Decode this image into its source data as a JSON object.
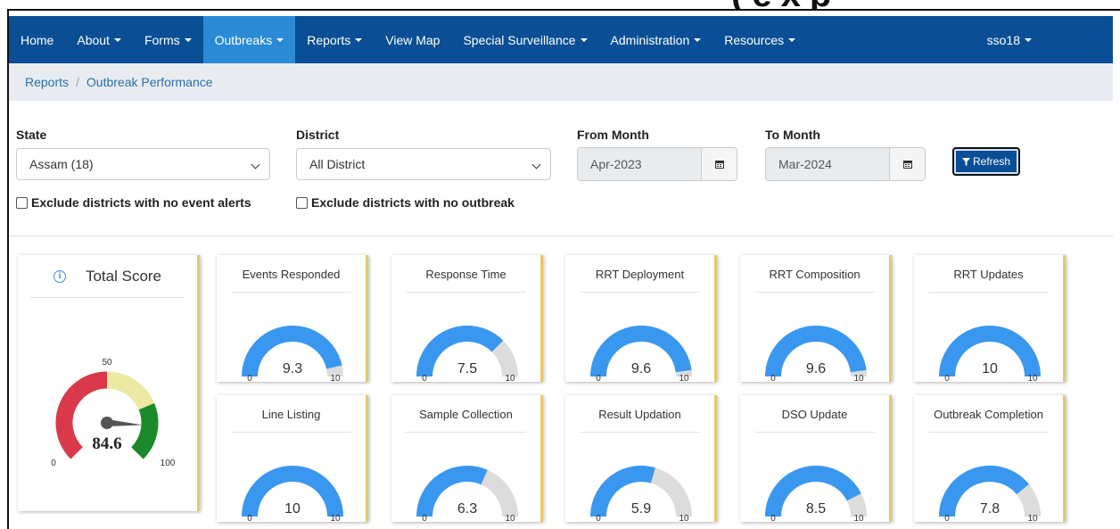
{
  "header_fragment": "(exp",
  "nav": {
    "items": [
      {
        "label": "Home",
        "caret": false,
        "active": false
      },
      {
        "label": "About",
        "caret": true,
        "active": false
      },
      {
        "label": "Forms",
        "caret": true,
        "active": false
      },
      {
        "label": "Outbreaks",
        "caret": true,
        "active": true
      },
      {
        "label": "Reports",
        "caret": true,
        "active": false
      },
      {
        "label": "View Map",
        "caret": false,
        "active": false
      },
      {
        "label": "Special Surveillance",
        "caret": true,
        "active": false
      },
      {
        "label": "Administration",
        "caret": true,
        "active": false
      },
      {
        "label": "Resources",
        "caret": true,
        "active": false
      }
    ],
    "user": "sso18"
  },
  "breadcrumb": {
    "parent": "Reports",
    "separator": "/",
    "current": "Outbreak Performance"
  },
  "filters": {
    "state_label": "State",
    "state_value": "Assam (18)",
    "district_label": "District",
    "district_value": "All District",
    "from_label": "From Month",
    "from_value": "Apr-2023",
    "to_label": "To Month",
    "to_value": "Mar-2024",
    "refresh_label": "Refresh",
    "exclude_alerts_label": "Exclude districts with no event alerts",
    "exclude_outbreak_label": "Exclude districts with no outbreak"
  },
  "total_score": {
    "title": "Total Score",
    "value": "84.6",
    "min": "0",
    "mid": "50",
    "max": "100",
    "band_colors": [
      "#d9394a",
      "#ede8a2",
      "#1a8a2a"
    ]
  },
  "colors": {
    "gauge_fill": "#3a97f0",
    "gauge_track": "#dcdcdc",
    "nav_bg": "#0a4f95",
    "nav_active": "#2a8ad6"
  },
  "metrics": [
    {
      "title": "Events Responded",
      "value": "9.3",
      "min": "0",
      "max": "10"
    },
    {
      "title": "Response Time",
      "value": "7.5",
      "min": "0",
      "max": "10"
    },
    {
      "title": "RRT Deployment",
      "value": "9.6",
      "min": "0",
      "max": "10"
    },
    {
      "title": "RRT Composition",
      "value": "9.6",
      "min": "0",
      "max": "10"
    },
    {
      "title": "RRT Updates",
      "value": "10",
      "min": "0",
      "max": "10"
    },
    {
      "title": "Line Listing",
      "value": "10",
      "min": "0",
      "max": "10"
    },
    {
      "title": "Sample Collection",
      "value": "6.3",
      "min": "0",
      "max": "10"
    },
    {
      "title": "Result Updation",
      "value": "5.9",
      "min": "0",
      "max": "10"
    },
    {
      "title": "DSO Update",
      "value": "8.5",
      "min": "0",
      "max": "10"
    },
    {
      "title": "Outbreak Completion",
      "value": "7.8",
      "min": "0",
      "max": "10"
    }
  ]
}
